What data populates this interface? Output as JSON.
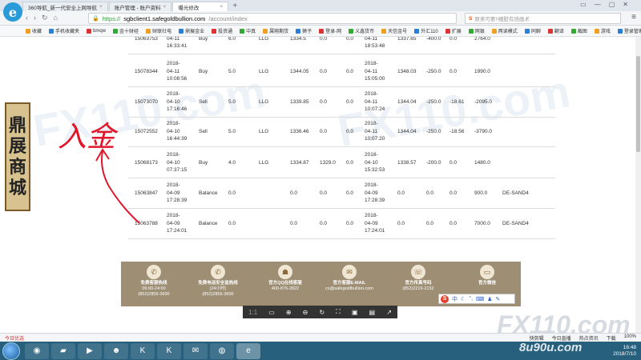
{
  "browser": {
    "logo_glyph": "e",
    "tabs": [
      {
        "label": "360导航_新一代安全上网导航",
        "active": false
      },
      {
        "label": "账户管理 - 账户资料",
        "active": false
      },
      {
        "label": "曝光修改",
        "active": true
      }
    ],
    "new_tab": "+",
    "address": {
      "scheme": "https://",
      "host": "sgbclient1.safegoldbullion.com",
      "path": "/account/index"
    },
    "search_placeholder": "原来可要!!细脏有烧画术",
    "favorites": [
      "收藏",
      "手机收藏夹",
      "bmqw",
      "金十财经",
      "财联社电",
      "鼎展金业",
      "投资通",
      "中真",
      "属翔期货",
      "狮子",
      "登录-网",
      "义鑫货币",
      "天信金号",
      "外汇110",
      "扩展",
      "网银",
      "两读模式",
      "同聊",
      "翻译",
      "截图",
      "游戏",
      "登录管家"
    ]
  },
  "table": {
    "rows": [
      {
        "id": "15063753",
        "open_time": "2018-\n04-11\n16:33:41",
        "type": "Buy",
        "lots": "6.0",
        "symbol": "LLG",
        "open_price": "1334.5",
        "sl": "0.0",
        "tp": "0.0",
        "close_time": "2018-\n04-11\n18:53:48",
        "close_price": "1337.65",
        "commission": "-400.0",
        "swap": "0.0",
        "profit": "2764.0",
        "comment": ""
      },
      {
        "id": "15078344",
        "open_time": "2018-\n04-11\n10:08:56",
        "type": "Buy",
        "lots": "5.0",
        "symbol": "LLG",
        "open_price": "1344.05",
        "sl": "0.0",
        "tp": "0.0",
        "close_time": "2018-\n04-11\n15:05:00",
        "close_price": "1348.03",
        "commission": "-250.0",
        "swap": "0.0",
        "profit": "1990.0",
        "comment": ""
      },
      {
        "id": "15073070",
        "open_time": "2018-\n04-10\n17:16:46",
        "type": "Sell",
        "lots": "5.0",
        "symbol": "LLG",
        "open_price": "1339.85",
        "sl": "0.0",
        "tp": "0.0",
        "close_time": "2018-\n04-11\n10:07:24",
        "close_price": "1344.04",
        "commission": "-250.0",
        "swap": "-18.61",
        "profit": "-2095.0",
        "comment": ""
      },
      {
        "id": "15072552",
        "open_time": "2018-\n04-10\n16:44:39",
        "type": "Sell",
        "lots": "5.0",
        "symbol": "LLG",
        "open_price": "1336.46",
        "sl": "0.0",
        "tp": "0.0",
        "close_time": "2018-\n04-11\n10:07:20",
        "close_price": "1344.04",
        "commission": "-250.0",
        "swap": "-18.56",
        "profit": "-3790.0",
        "comment": ""
      },
      {
        "id": "15068173",
        "open_time": "2018-\n04-10\n07:37:15",
        "type": "Buy",
        "lots": "4.0",
        "symbol": "LLG",
        "open_price": "1334.87",
        "sl": "1329.0",
        "tp": "0.0",
        "close_time": "2018-\n04-10\n15:32:53",
        "close_price": "1338.57",
        "commission": "-200.0",
        "swap": "0.0",
        "profit": "1480.0",
        "comment": ""
      },
      {
        "id": "15063847",
        "open_time": "2018-\n04-09\n17:28:39",
        "type": "Balance",
        "lots": "0.0",
        "symbol": "",
        "open_price": "0.0",
        "sl": "0.0",
        "tp": "0.0",
        "close_time": "2018-\n04-09\n17:28:39",
        "close_price": "0.0",
        "commission": "0.0",
        "swap": "0.0",
        "profit": "900.0",
        "comment": "DE-SAND4"
      },
      {
        "id": "15063788",
        "open_time": "2018-\n04-09\n17:24:01",
        "type": "Balance",
        "lots": "0.0",
        "symbol": "",
        "open_price": "0.0",
        "sl": "0.0",
        "tp": "0.0",
        "close_time": "2018-\n04-09\n17:24:01",
        "close_price": "0.0",
        "commission": "0.0",
        "swap": "0.0",
        "profit": "7000.0",
        "comment": "DE-SAND4"
      }
    ]
  },
  "watermark": "FX110.com",
  "banner_chars": [
    "鼎",
    "展",
    "商",
    "城"
  ],
  "annotation_text": "入金",
  "footer": {
    "items": [
      {
        "title": "免费客服热线",
        "detail": "09:00-24:00\n(852)2855-3600",
        "icon": "phone-icon"
      },
      {
        "title": "免费电话安全监热线",
        "detail": "(24小时)\n(852)2855-3600",
        "icon": "phone-icon"
      },
      {
        "title": "官方QQ在线客服",
        "detail": "400-876-2822",
        "icon": "qq-icon"
      },
      {
        "title": "官方客服E-MAIL",
        "detail": "cs@safegoldbullion.com",
        "icon": "mail-icon"
      },
      {
        "title": "官方传真号码",
        "detail": "(852)2219-2152",
        "icon": "fax-icon"
      },
      {
        "title": "官方微信",
        "detail": "",
        "icon": "monitor-icon"
      }
    ]
  },
  "image_viewer": {
    "ratio": "1:1"
  },
  "fx_logo": "FX110.com",
  "status": {
    "left": "今日优选",
    "right": [
      "快剪辑",
      "今日直播",
      "热点资讯",
      "下载",
      "100%"
    ]
  },
  "taskbar": {
    "icons": [
      "chrome-icon",
      "folder-icon",
      "media-icon",
      "penguin-icon",
      "k-icon",
      "k2-icon",
      "wechat-icon",
      "green-icon",
      "ie-icon"
    ],
    "time": "16:48",
    "date": "2018/7/10"
  },
  "bottom_watermark": "8u90u.com"
}
